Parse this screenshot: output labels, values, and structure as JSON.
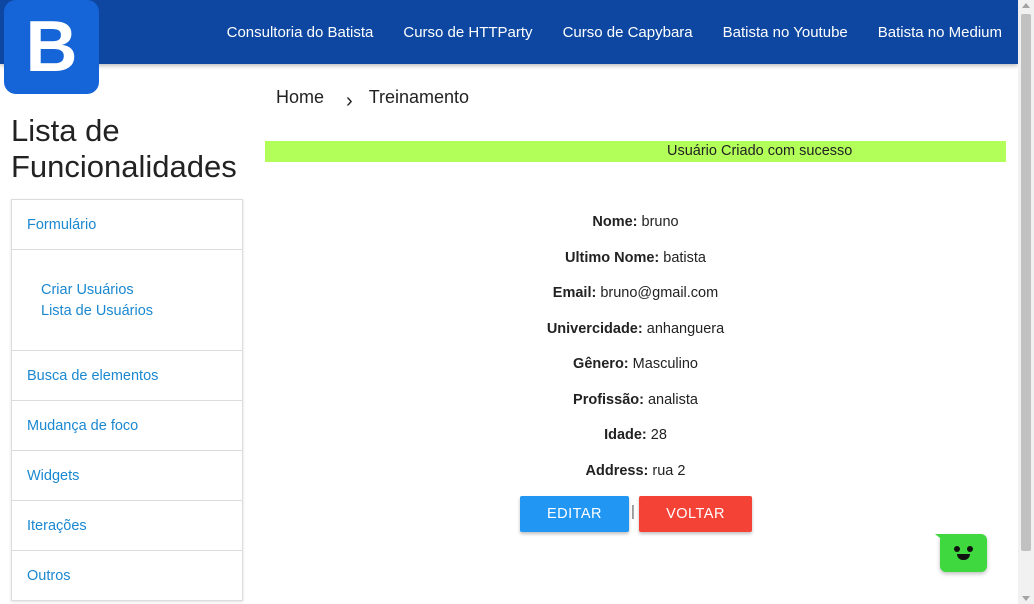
{
  "logo": {
    "letter": "B"
  },
  "nav": {
    "links": [
      "Consultoria do Batista",
      "Curso de HTTParty",
      "Curso de Capybara",
      "Batista no Youtube",
      "Batista no Medium"
    ]
  },
  "sidebar": {
    "title_line1": "Lista de",
    "title_line2": "Funcionalidades",
    "items": {
      "formulario": "Formulário",
      "criar_usuarios": "Criar Usuários",
      "lista_usuarios": "Lista de Usuários",
      "busca": "Busca de elementos",
      "foco": "Mudança de foco",
      "widgets": "Widgets",
      "iteracoes": "Iterações",
      "outros": "Outros"
    }
  },
  "breadcrumb": {
    "home": "Home",
    "separator": "›",
    "current": "Treinamento"
  },
  "alert": {
    "text": "Usuário Criado com sucesso",
    "color": "#b2ff59"
  },
  "user": [
    {
      "label": "Nome:",
      "value": "bruno"
    },
    {
      "label": "Ultimo Nome:",
      "value": "batista"
    },
    {
      "label": "Email:",
      "value": "bruno@gmail.com"
    },
    {
      "label": "Univercidade:",
      "value": "anhanguera"
    },
    {
      "label": "Gênero:",
      "value": "Masculino"
    },
    {
      "label": "Profissão:",
      "value": "analista"
    },
    {
      "label": "Idade:",
      "value": "28"
    },
    {
      "label": "Address:",
      "value": "rua 2"
    }
  ],
  "actions": {
    "edit": "EDITAR",
    "separator": "|",
    "back": "VOLTAR"
  },
  "colors": {
    "navbar": "#0d47a1",
    "logo": "#1565d8",
    "link": "#1a88d0",
    "edit": "#2196f3",
    "back": "#f44336",
    "chat": "#3fd83f"
  },
  "chat": {
    "icon": "smiley-chat-icon"
  }
}
